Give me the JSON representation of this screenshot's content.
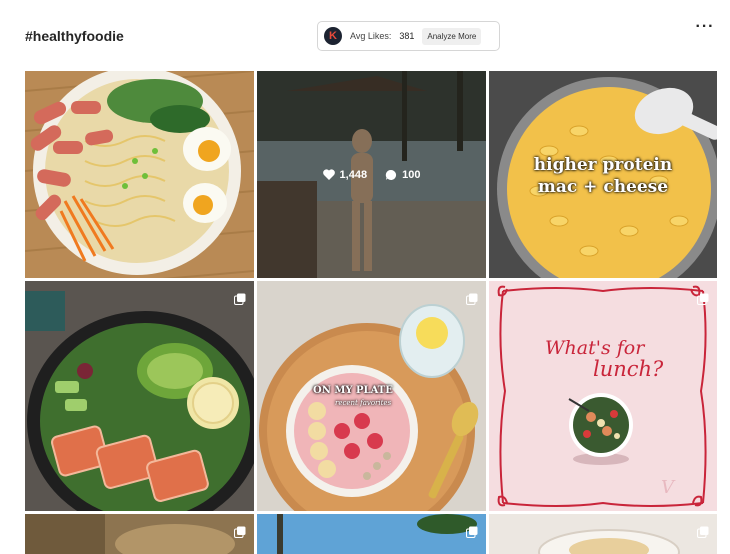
{
  "header": {
    "hashtag": "#healthyfoodie",
    "more_label": "···"
  },
  "stats": {
    "logo_letter": "K",
    "avg_label": "Avg Likes:",
    "avg_value": "381",
    "analyze_label": "Analyze More"
  },
  "posts": [
    {
      "id": "ramen",
      "type": "image"
    },
    {
      "id": "beach",
      "type": "image",
      "likes": "1,448",
      "comments": "100"
    },
    {
      "id": "mac",
      "type": "image",
      "caption_line1": "higher protein",
      "caption_line2": "mac + cheese"
    },
    {
      "id": "salmon",
      "type": "carousel"
    },
    {
      "id": "smoothie",
      "type": "carousel",
      "overlay_title": "ON MY PLATE",
      "overlay_sub": "recent favorites"
    },
    {
      "id": "lunch",
      "type": "carousel",
      "line1": "What's for",
      "line2": "lunch?",
      "watermark": "V"
    },
    {
      "id": "row3-a",
      "type": "carousel"
    },
    {
      "id": "row3-b",
      "type": "carousel"
    },
    {
      "id": "row3-c",
      "type": "carousel"
    }
  ],
  "colors": {
    "lunch_red": "#c9253a",
    "lunch_bg": "#f5dde0"
  }
}
